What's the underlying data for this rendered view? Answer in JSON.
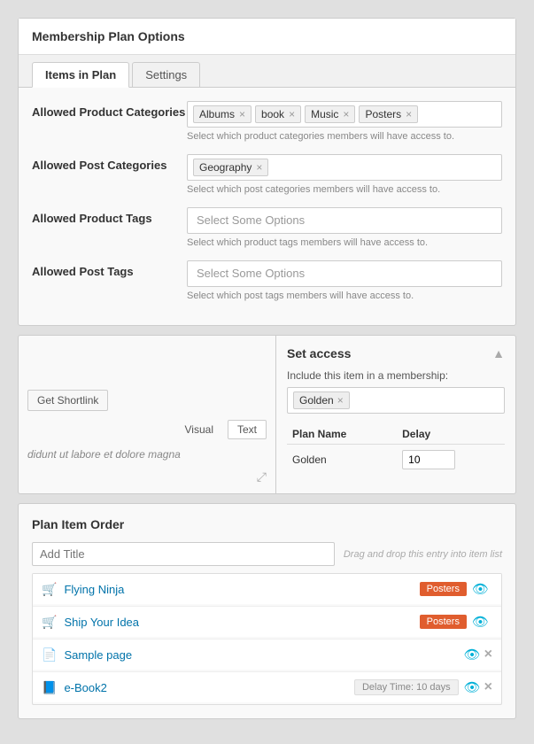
{
  "membership_panel": {
    "title": "Membership Plan Options",
    "tabs": [
      {
        "label": "Items in Plan",
        "active": true
      },
      {
        "label": "Settings",
        "active": false
      }
    ],
    "allowed_product_categories": {
      "label": "Allowed Product Categories",
      "tags": [
        "Albums",
        "book",
        "Music",
        "Posters"
      ],
      "hint": "Select which product categories members will have access to."
    },
    "allowed_post_categories": {
      "label": "Allowed Post Categories",
      "tags": [
        "Geography"
      ],
      "hint": "Select which post categories members will have access to."
    },
    "allowed_product_tags": {
      "label": "Allowed Product Tags",
      "placeholder": "Select Some Options",
      "hint": "Select which product tags members will have access to."
    },
    "allowed_post_tags": {
      "label": "Allowed Post Tags",
      "placeholder": "Select Some Options",
      "hint": "Select which post tags members will have access to."
    }
  },
  "editor_panel": {
    "shortlink_btn": "Get Shortlink",
    "editor_tabs": [
      {
        "label": "Visual",
        "active": false
      },
      {
        "label": "Text",
        "active": true
      }
    ],
    "editor_text": "didunt ut labore et dolore magna"
  },
  "set_access": {
    "title": "Set access",
    "include_label": "Include this item in a membership:",
    "membership_tags": [
      "Golden"
    ],
    "table": {
      "headers": [
        "Plan Name",
        "Delay"
      ],
      "rows": [
        {
          "plan": "Golden",
          "delay": "10"
        }
      ]
    }
  },
  "plan_order": {
    "title": "Plan Item Order",
    "add_title_placeholder": "Add Title",
    "drag_hint": "Drag and drop this entry into item list",
    "items": [
      {
        "icon": "cart",
        "name": "Flying Ninja",
        "badge": "Posters",
        "delay": null
      },
      {
        "icon": "cart",
        "name": "Ship Your Idea",
        "badge": "Posters",
        "delay": null
      },
      {
        "icon": "page",
        "name": "Sample page",
        "badge": null,
        "delay": null
      },
      {
        "icon": "book",
        "name": "e-Book2",
        "badge": null,
        "delay": "Delay Time: 10 days"
      }
    ]
  }
}
